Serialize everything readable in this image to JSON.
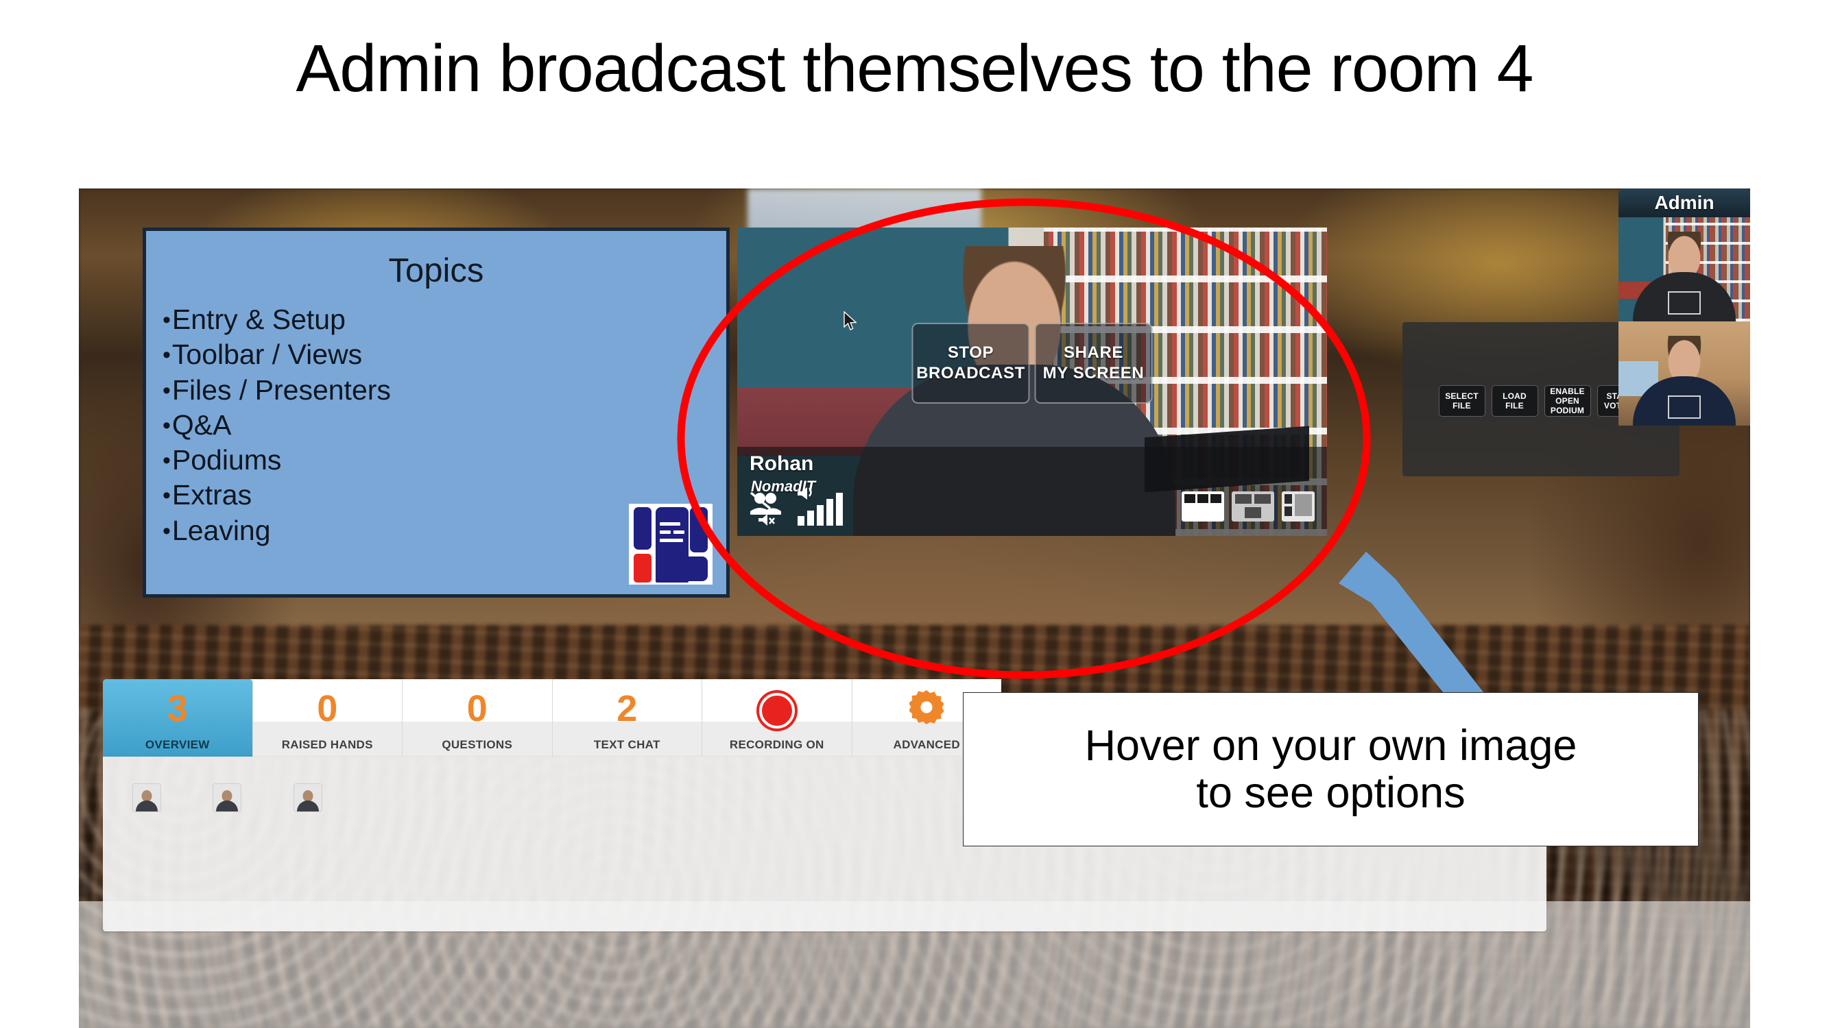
{
  "slide": {
    "title": "Admin broadcast themselves to the room 4"
  },
  "topics_panel": {
    "heading": "Topics",
    "items": [
      "Entry & Setup",
      "Toolbar / Views",
      "Files / Presenters",
      "Q&A",
      "Podiums",
      "Extras",
      "Leaving"
    ],
    "logo_name": "nomadit-logo",
    "background_color": "#7ba7d7"
  },
  "main_video": {
    "participant_name": "Rohan",
    "participant_org": "NomadIT",
    "hover_buttons": [
      {
        "label": "STOP\nBROADCAST",
        "line1": "STOP",
        "line2": "BROADCAST",
        "name": "stop-broadcast-button"
      },
      {
        "label": "SHARE\nMY SCREEN",
        "line1": "SHARE",
        "line2": "MY SCREEN",
        "name": "share-my-screen-button"
      }
    ],
    "status_icons": [
      "people-muted-icon",
      "speaker-muted-icon",
      "speaker-icon",
      "signal-strength-icon"
    ],
    "view_layout_icons": [
      "layout-filmstrip-icon",
      "layout-grid-icon",
      "layout-sidebar-icon"
    ],
    "cursor": "mouse-pointer-icon"
  },
  "right_panel": {
    "buttons": [
      {
        "line1": "SELECT",
        "line2": "FILE",
        "name": "select-file-button"
      },
      {
        "line1": "LOAD",
        "line2": "FILE",
        "name": "load-file-button"
      },
      {
        "line1": "ENABLE",
        "line2": "OPEN",
        "line3": "PODIUM",
        "name": "enable-open-podium-button"
      },
      {
        "line1": "START",
        "line2": "VOTING",
        "name": "start-voting-button"
      }
    ]
  },
  "admin_column": {
    "badge_label": "Admin",
    "tiles": [
      {
        "name": "admin-self-view-tile-1"
      },
      {
        "name": "admin-self-view-tile-2"
      }
    ]
  },
  "toolbar": {
    "items": [
      {
        "value": "3",
        "label": "OVERVIEW",
        "active": true,
        "icon": null
      },
      {
        "value": "0",
        "label": "RAISED HANDS",
        "active": false,
        "icon": null
      },
      {
        "value": "0",
        "label": "QUESTIONS",
        "active": false,
        "icon": null
      },
      {
        "value": "2",
        "label": "TEXT CHAT",
        "active": false,
        "icon": null
      },
      {
        "value": "",
        "label": "RECORDING ON",
        "active": false,
        "icon": "record-dot-icon"
      },
      {
        "value": "",
        "label": "ADVANCED",
        "active": false,
        "icon": "gear-icon"
      }
    ],
    "accent_color": "#f0862a",
    "active_color": "#4fb0d8"
  },
  "participants": {
    "count": 3,
    "thumbnails": [
      {
        "name": "participant-thumbnail-1"
      },
      {
        "name": "participant-thumbnail-2"
      },
      {
        "name": "participant-thumbnail-3"
      }
    ]
  },
  "annotations": {
    "ellipse": {
      "name": "red-highlight-ellipse",
      "color": "#ff0000"
    },
    "arrow": {
      "name": "blue-callout-arrow",
      "color": "#6a9fd4"
    },
    "callout": {
      "line1": "Hover on your own image",
      "line2": "to see options"
    }
  }
}
